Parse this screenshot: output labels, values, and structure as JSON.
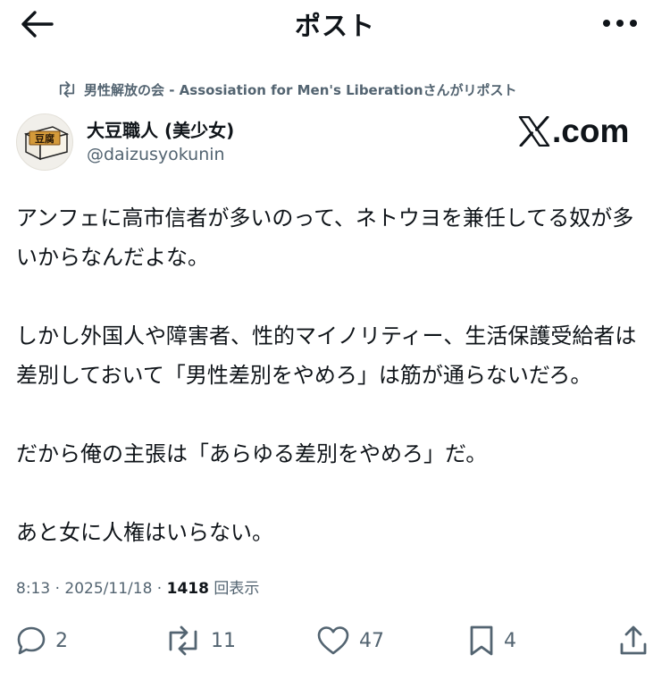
{
  "header": {
    "title": "ポスト",
    "back_icon": "arrow-left-icon",
    "more_icon": "more-dots-icon"
  },
  "repost_context": {
    "text": "男性解放の会 - Assosiation for Men's Liberationさんがリポスト",
    "icon": "repost-icon"
  },
  "author": {
    "display_name": "大豆職人 (美少女)",
    "handle": "@daizusyokunin",
    "avatar_icon": "tofu-avatar-icon",
    "avatar_text": "豆腐"
  },
  "badge": {
    "text": ".com"
  },
  "tweet": {
    "paragraphs": [
      "アンフェに高市信者が多いのって、ネトウヨを兼任してる奴が多いからなんだよな。",
      "しかし外国人や障害者、性的マイノリティー、生活保護受給者は差別しておいて「男性差別をやめろ」は筋が通らないだろ。",
      "だから俺の主張は「あらゆる差別をやめろ」だ。",
      "あと女に人権はいらない。"
    ]
  },
  "meta": {
    "time": "8:13",
    "separator": "·",
    "date": "2025/11/18",
    "views_count": "1418",
    "views_label": "回表示"
  },
  "actions": {
    "reply": {
      "icon": "reply-icon",
      "count": "2"
    },
    "repost": {
      "icon": "repost-icon",
      "count": "11"
    },
    "like": {
      "icon": "heart-icon",
      "count": "47"
    },
    "bookmark": {
      "icon": "bookmark-icon",
      "count": "4"
    },
    "share": {
      "icon": "share-icon"
    }
  },
  "colors": {
    "text_primary": "#0f1419",
    "text_secondary": "#536471",
    "background": "#ffffff"
  }
}
